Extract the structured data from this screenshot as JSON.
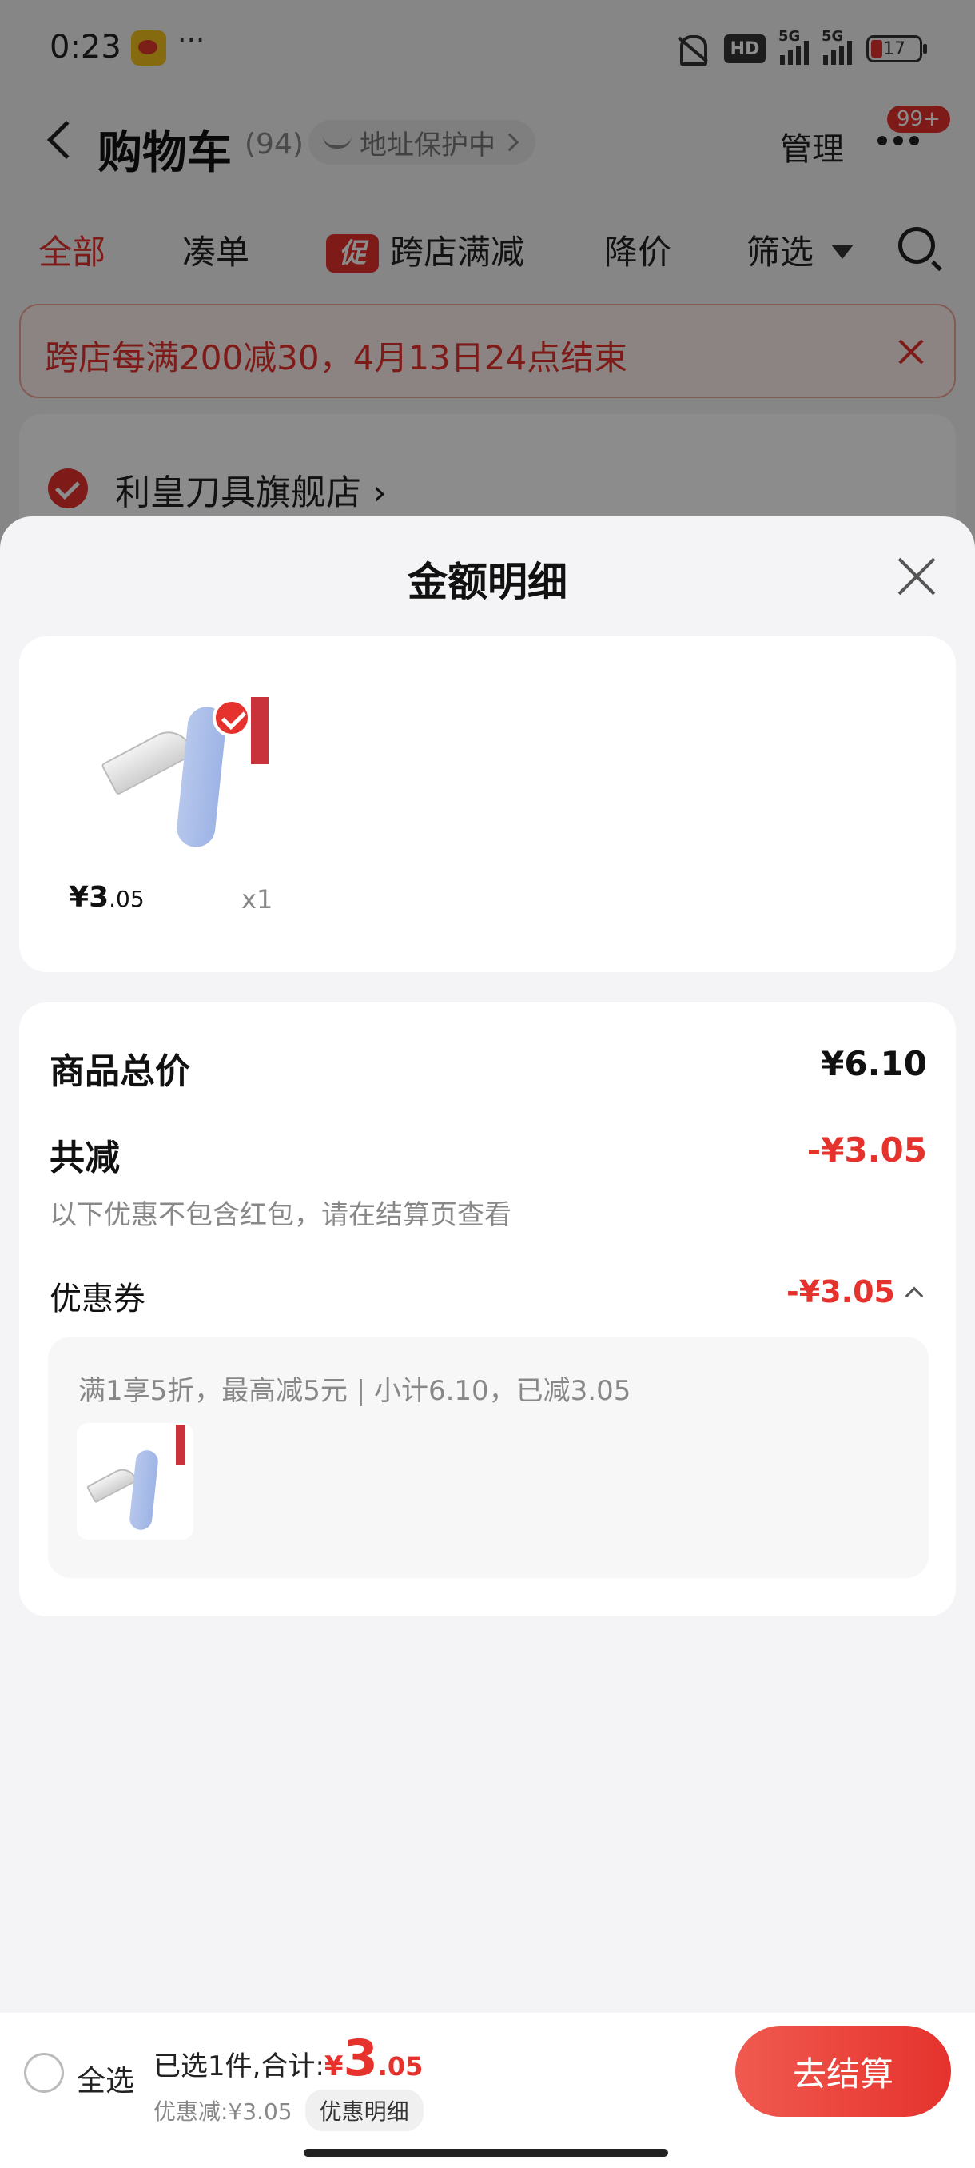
{
  "status_bar": {
    "time": "0:23",
    "dots": "···",
    "hd": "HD",
    "signal1": "5G",
    "signal2": "5G",
    "battery": "17"
  },
  "nav": {
    "title": "购物车",
    "count": "(94)",
    "address_protect": "地址保护中",
    "manage": "管理",
    "badge": "99+"
  },
  "tabs": [
    {
      "label": "全部"
    },
    {
      "label": "凑单"
    },
    {
      "label": "跨店满减",
      "tag": "促"
    },
    {
      "label": "降价"
    },
    {
      "label": "筛选"
    }
  ],
  "promo_banner": {
    "text": "跨店每满200减30，4月13日24点结束"
  },
  "store": {
    "name": "利皇刀具旗舰店"
  },
  "sheet": {
    "title": "金额明细",
    "product": {
      "yen": "¥",
      "price_int": "3",
      "price_dec": ".05",
      "qty": "x1"
    },
    "total": {
      "label": "商品总价",
      "value": "¥6.10"
    },
    "reduction": {
      "label": "共减",
      "value": "-¥3.05",
      "note": "以下优惠不包含红包，请在结算页查看"
    },
    "coupon": {
      "label": "优惠券",
      "value": "-¥3.05",
      "desc": "满1享5折，最高减5元 | 小计6.10，已减3.05"
    }
  },
  "bottom_bar": {
    "select_all": "全选",
    "summary_prefix": "已选1件,合计:",
    "yen": "¥",
    "total_int": "3",
    "total_dec": ".05",
    "discount": "优惠减:¥3.05",
    "detail_pill": "优惠明细",
    "checkout": "去结算"
  },
  "colors": {
    "accent": "#e5322d",
    "background": "#f4f4f6"
  }
}
